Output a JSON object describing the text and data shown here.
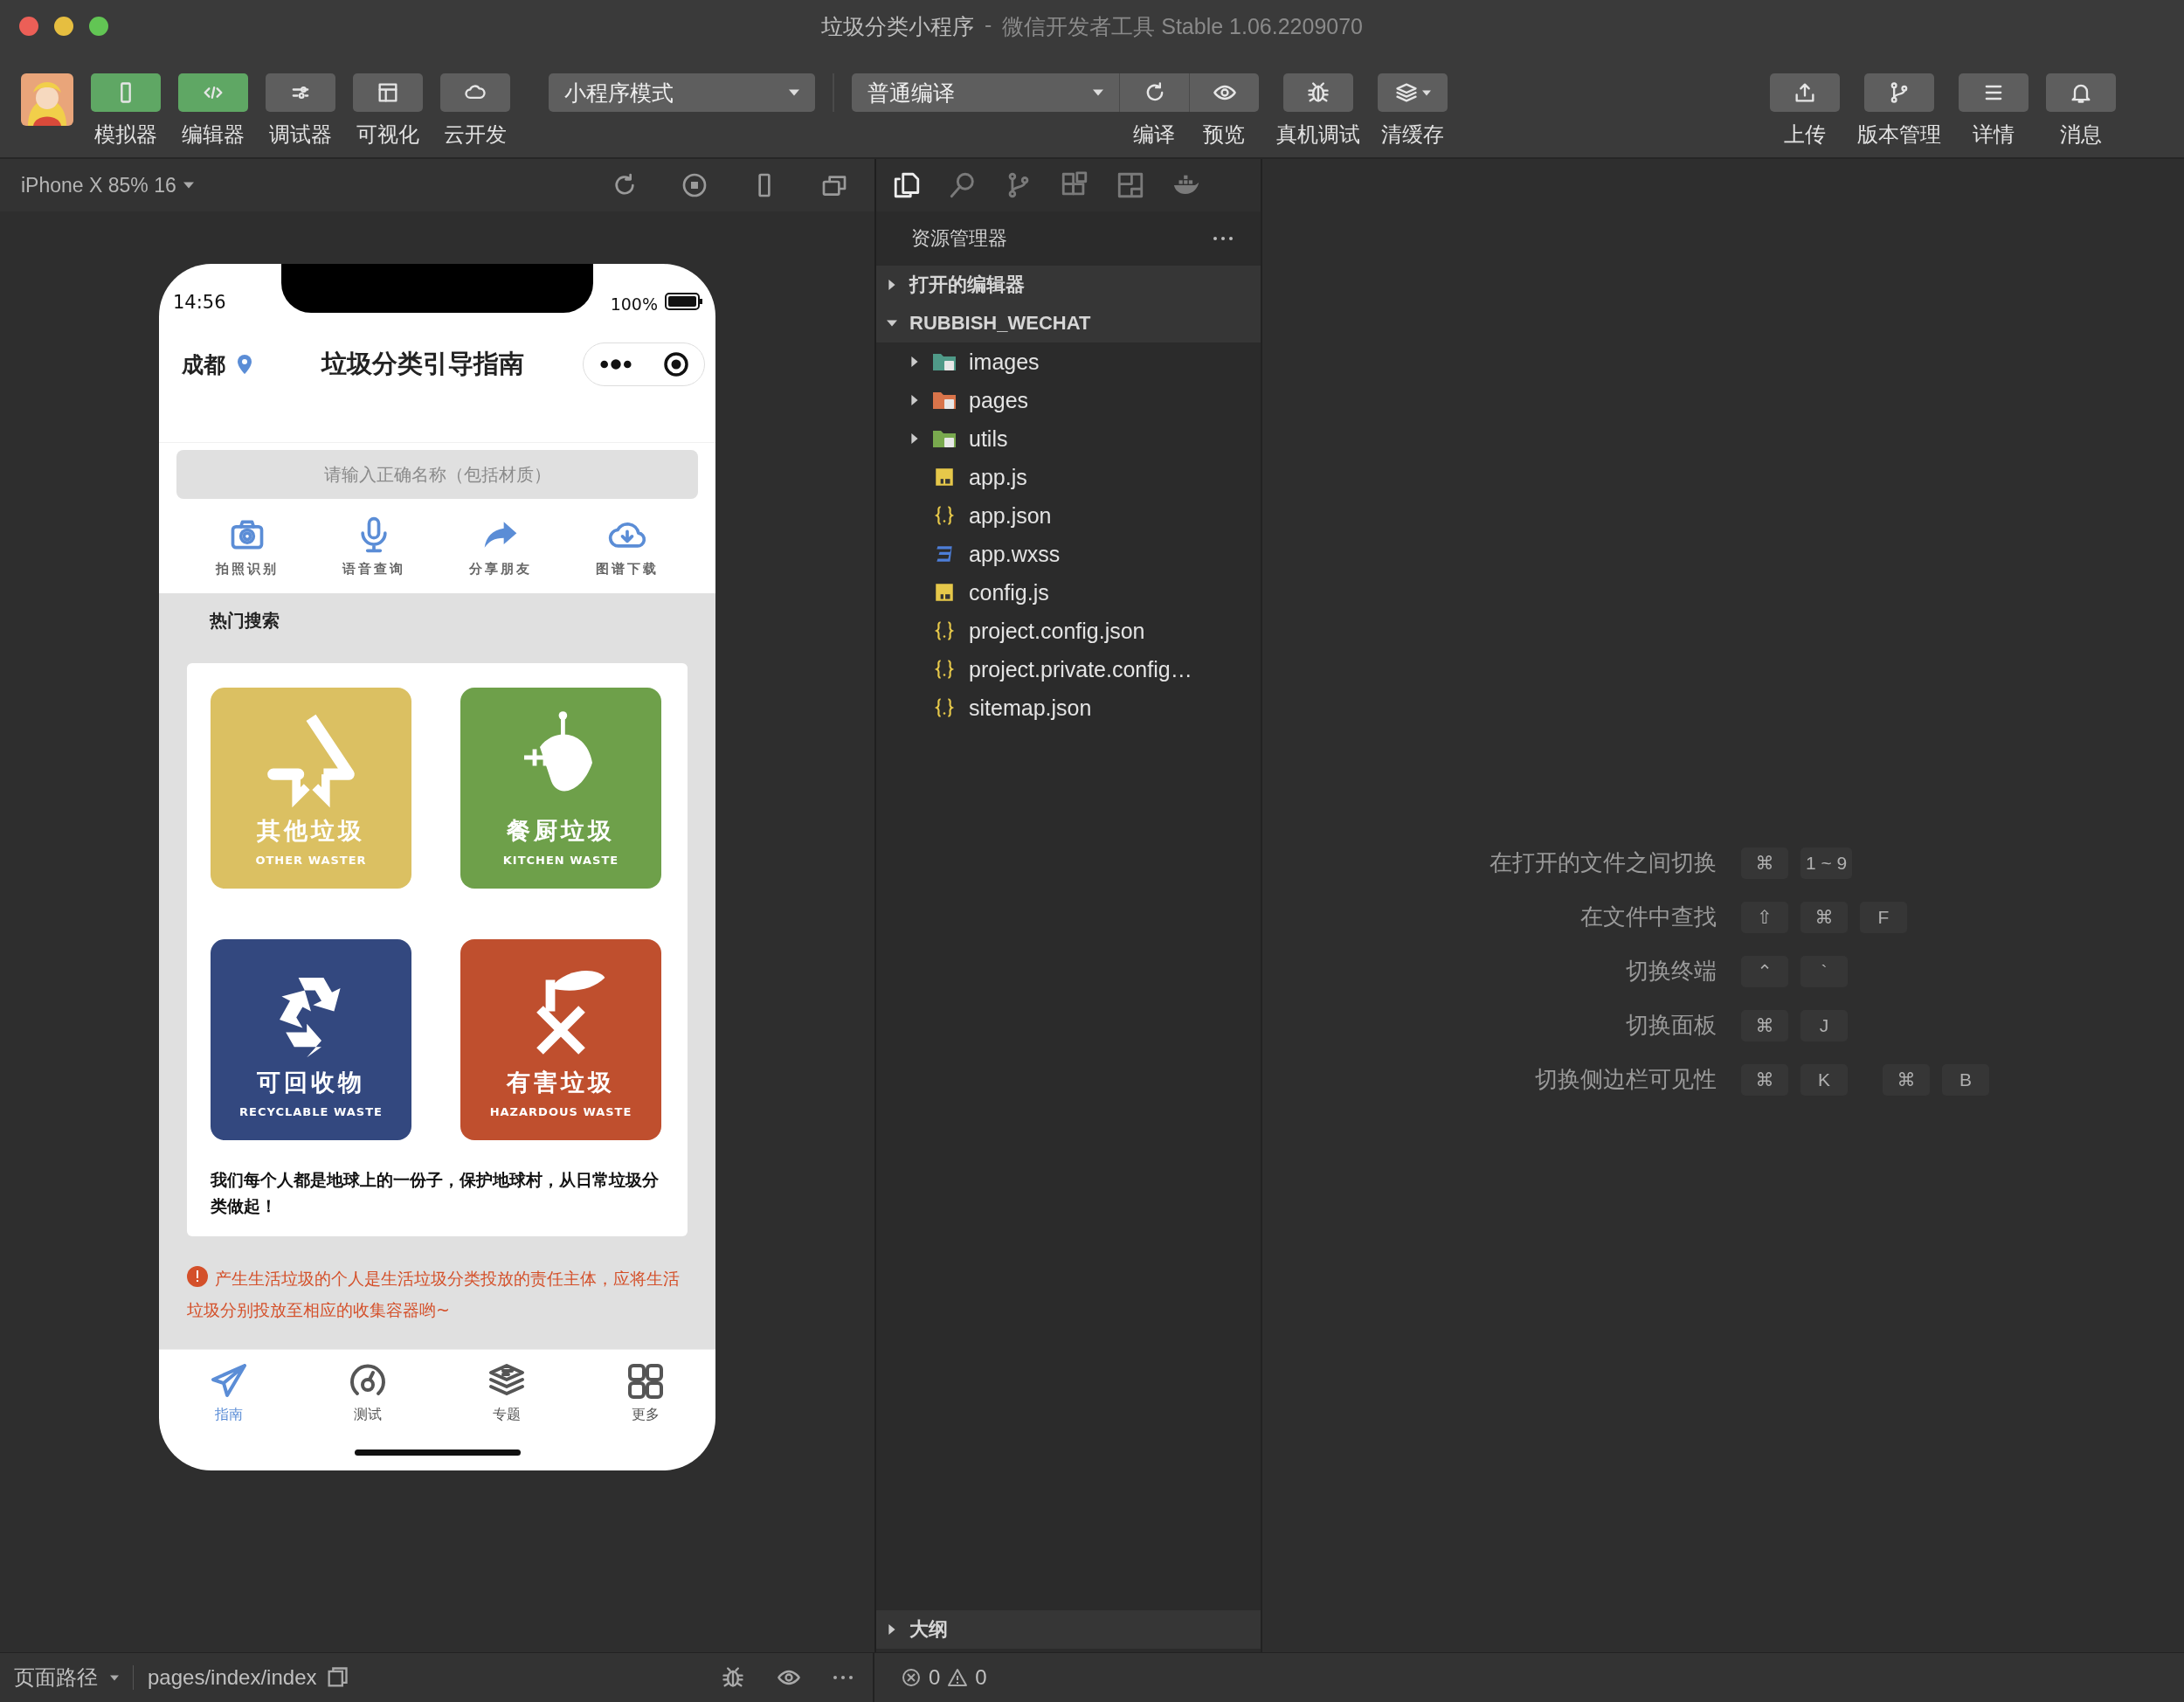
{
  "window": {
    "title": "垃圾分类小程序",
    "separator": "-",
    "app": "微信开发者工具 Stable 1.06.2209070"
  },
  "toolbar": {
    "views": [
      {
        "label": "模拟器",
        "kind": "phone",
        "on": true
      },
      {
        "label": "编辑器",
        "kind": "code",
        "on": true
      },
      {
        "label": "调试器",
        "kind": "sliders",
        "on": false
      },
      {
        "label": "可视化",
        "kind": "layout",
        "on": false
      },
      {
        "label": "云开发",
        "kind": "cloud",
        "on": false
      }
    ],
    "mode": "小程序模式",
    "compile_mode": "普通编译",
    "compile_actions": [
      {
        "label": "编译",
        "kind": "refresh"
      },
      {
        "label": "预览",
        "kind": "eye"
      }
    ],
    "tools": [
      {
        "label": "真机调试",
        "kind": "bug",
        "caret": false
      },
      {
        "label": "清缓存",
        "kind": "layers",
        "caret": true
      }
    ],
    "right": [
      {
        "label": "上传",
        "kind": "upload"
      },
      {
        "label": "版本管理",
        "kind": "branch"
      },
      {
        "label": "详情",
        "kind": "list"
      },
      {
        "label": "消息",
        "kind": "bell"
      }
    ]
  },
  "simulator": {
    "device": "iPhone X 85% 16",
    "phone": {
      "time": "14:56",
      "battery": "100%",
      "city": "成都",
      "title": "垃圾分类引导指南",
      "search": {
        "placeholder": "请输入正确名称（包括材质）"
      },
      "actions": [
        {
          "label": "拍照识别",
          "kind": "camera"
        },
        {
          "label": "语音查询",
          "kind": "microphone"
        },
        {
          "label": "分享朋友",
          "kind": "share"
        },
        {
          "label": "图谱下载",
          "kind": "download"
        }
      ],
      "section_title": "热门搜索",
      "categories": [
        {
          "name": "其他垃圾",
          "english": "OTHER WASTER",
          "kind": "other",
          "color": "#dbc062"
        },
        {
          "name": "餐厨垃圾",
          "english": "KITCHEN WASTE",
          "kind": "kitchen",
          "color": "#6ea04a"
        },
        {
          "name": "可回收物",
          "english": "RECYCLABLE WASTE",
          "kind": "recyclable",
          "color": "#33487f"
        },
        {
          "name": "有害垃圾",
          "english": "HAZARDOUS WASTE",
          "kind": "hazardous",
          "color": "#bf4f2e"
        }
      ],
      "slogan": "我们每个人都是地球上的一份子，保护地球村，从日常垃圾分类做起！",
      "notice": "产生生活垃圾的个人是生活垃圾分类投放的责任主体，应将生活垃圾分别投放至相应的收集容器哟~",
      "tabs": [
        {
          "label": "指南",
          "kind": "plane",
          "selected": true
        },
        {
          "label": "测试",
          "kind": "gauge",
          "selected": false
        },
        {
          "label": "专题",
          "kind": "stack",
          "selected": false
        },
        {
          "label": "更多",
          "kind": "grid",
          "selected": false
        }
      ]
    }
  },
  "explorer": {
    "title": "资源管理器",
    "open_editors": {
      "label": "打开的编辑器",
      "expanded": false
    },
    "project": {
      "label": "RUBBISH_WECHAT",
      "expanded": true,
      "children": [
        {
          "label": "images",
          "kind": "folder",
          "color": "#4f9a88",
          "expanded": false
        },
        {
          "label": "pages",
          "kind": "folder",
          "color": "#d9744a",
          "expanded": false
        },
        {
          "label": "utils",
          "kind": "folder",
          "color": "#79a94e",
          "expanded": false
        },
        {
          "label": "app.js",
          "kind": "js"
        },
        {
          "label": "app.json",
          "kind": "json"
        },
        {
          "label": "app.wxss",
          "kind": "css"
        },
        {
          "label": "config.js",
          "kind": "js"
        },
        {
          "label": "project.config.json",
          "kind": "json"
        },
        {
          "label": "project.private.config…",
          "kind": "json"
        },
        {
          "label": "sitemap.json",
          "kind": "json"
        }
      ]
    },
    "outline": {
      "label": "大纲",
      "expanded": false
    }
  },
  "shortcuts": [
    {
      "label": "在打开的文件之间切换",
      "keys": [
        [
          "⌘",
          "1 ~ 9"
        ]
      ]
    },
    {
      "label": "在文件中查找",
      "keys": [
        [
          "⇧",
          "⌘",
          "F"
        ]
      ]
    },
    {
      "label": "切换终端",
      "keys": [
        [
          "⌃",
          "`"
        ]
      ]
    },
    {
      "label": "切换面板",
      "keys": [
        [
          "⌘",
          "J"
        ]
      ]
    },
    {
      "label": "切换侧边栏可见性",
      "keys": [
        [
          "⌘",
          "K"
        ],
        [
          "⌘",
          "B"
        ]
      ]
    }
  ],
  "status_bar": {
    "page_path_label": "页面路径",
    "page_path": "pages/index/index",
    "errors": "0",
    "warnings": "0"
  }
}
